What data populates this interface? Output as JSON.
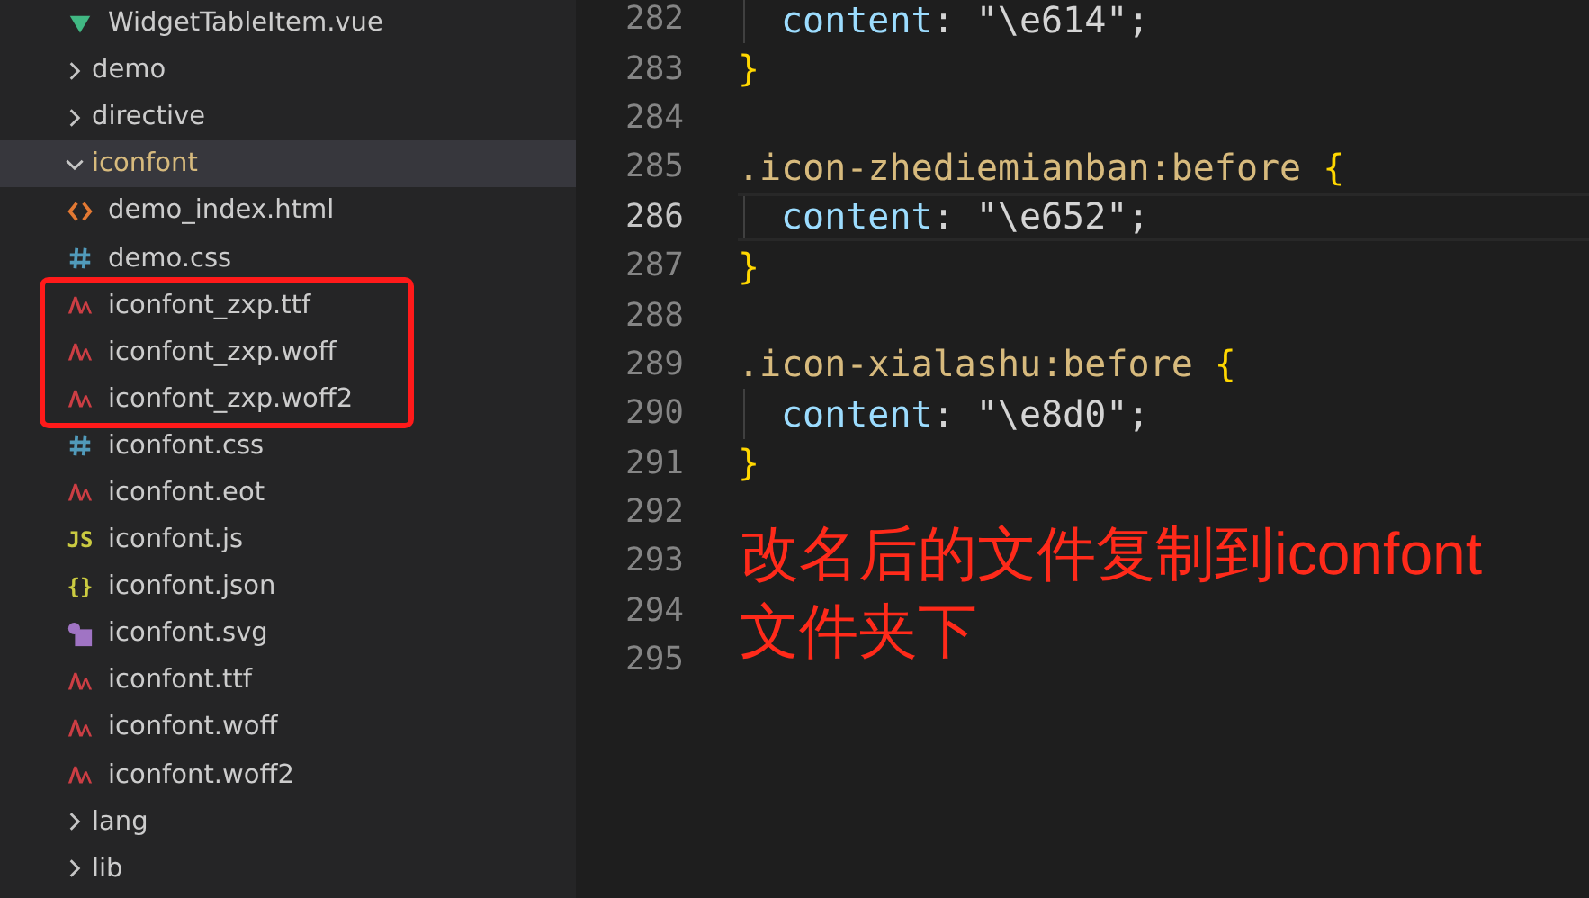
{
  "explorer": {
    "items": [
      {
        "name": "WidgetTableItem.vue",
        "kind": "vue",
        "selected": false,
        "framed": false
      },
      {
        "name": "demo",
        "kind": "folder",
        "expanded": false,
        "selected": false,
        "framed": false
      },
      {
        "name": "directive",
        "kind": "folder",
        "expanded": false,
        "selected": false,
        "framed": false
      },
      {
        "name": "iconfont",
        "kind": "folder",
        "expanded": true,
        "selected": true,
        "framed": false,
        "children": [
          {
            "name": "demo_index.html",
            "kind": "html",
            "selected": false,
            "framed": false
          },
          {
            "name": "demo.css",
            "kind": "css",
            "selected": false,
            "framed": false
          },
          {
            "name": "iconfont_zxp.ttf",
            "kind": "font",
            "selected": false,
            "framed": true
          },
          {
            "name": "iconfont_zxp.woff",
            "kind": "font",
            "selected": false,
            "framed": true
          },
          {
            "name": "iconfont_zxp.woff2",
            "kind": "font",
            "selected": false,
            "framed": true
          },
          {
            "name": "iconfont.css",
            "kind": "css",
            "selected": false,
            "framed": false
          },
          {
            "name": "iconfont.eot",
            "kind": "font",
            "selected": false,
            "framed": false
          },
          {
            "name": "iconfont.js",
            "kind": "js",
            "icon_text": "JS",
            "selected": false,
            "framed": false
          },
          {
            "name": "iconfont.json",
            "kind": "json",
            "icon_text": "{}",
            "selected": false,
            "framed": false
          },
          {
            "name": "iconfont.svg",
            "kind": "svg",
            "selected": false,
            "framed": false
          },
          {
            "name": "iconfont.ttf",
            "kind": "font",
            "selected": false,
            "framed": false
          },
          {
            "name": "iconfont.woff",
            "kind": "font",
            "selected": false,
            "framed": false
          },
          {
            "name": "iconfont.woff2",
            "kind": "font",
            "selected": false,
            "framed": false
          }
        ]
      },
      {
        "name": "lang",
        "kind": "folder",
        "expanded": false,
        "selected": false,
        "framed": false
      },
      {
        "name": "lib",
        "kind": "folder",
        "expanded": false,
        "selected": false,
        "framed": false
      }
    ]
  },
  "editor": {
    "lines": [
      {
        "number": "282",
        "kind": "declaration",
        "property": "content",
        "punct": ":",
        "value": "\"\\e614\";",
        "selected": false
      },
      {
        "number": "283",
        "kind": "close",
        "brace": "}",
        "selected": false
      },
      {
        "number": "284",
        "kind": "blank",
        "selected": false
      },
      {
        "number": "285",
        "kind": "rule",
        "selector": ".icon-zhediemianban:before",
        "brace": "{",
        "selected": false
      },
      {
        "number": "286",
        "kind": "declaration",
        "property": "content",
        "punct": ":",
        "value": "\"\\e652\";",
        "selected": true
      },
      {
        "number": "287",
        "kind": "close",
        "brace": "}",
        "selected": false
      },
      {
        "number": "288",
        "kind": "blank",
        "selected": false
      },
      {
        "number": "289",
        "kind": "rule",
        "selector": ".icon-xialashu:before",
        "brace": "{",
        "selected": false
      },
      {
        "number": "290",
        "kind": "declaration",
        "property": "content",
        "punct": ":",
        "value": "\"\\e8d0\";",
        "selected": false
      },
      {
        "number": "291",
        "kind": "close",
        "brace": "}",
        "selected": false
      },
      {
        "number": "292",
        "kind": "blank",
        "selected": false
      },
      {
        "number": "293",
        "kind": "blank",
        "selected": false
      },
      {
        "number": "294",
        "kind": "blank",
        "selected": false
      },
      {
        "number": "295",
        "kind": "blank",
        "selected": false
      }
    ],
    "annotation": "改名后的文件复制到iconfont文件夹下"
  }
}
